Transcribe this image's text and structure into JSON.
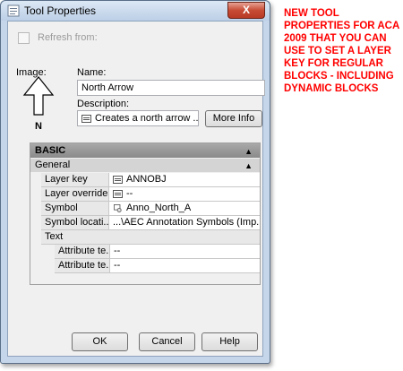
{
  "window": {
    "title": "Tool Properties",
    "close_symbol": "X"
  },
  "refresh": {
    "label": "Refresh from:"
  },
  "image": {
    "label": "Image:",
    "icon": "north-arrow-icon",
    "icon_letter": "N"
  },
  "name": {
    "label": "Name:",
    "value": "North Arrow"
  },
  "description": {
    "label": "Description:",
    "value": "Creates a north arrow ..."
  },
  "more_info": {
    "label": "More Info"
  },
  "grid": {
    "section": "BASIC",
    "category": "General",
    "collapse_symbol": "▲",
    "rows": [
      {
        "key": "Layer key",
        "value": "ANNOBJ",
        "icon": "doc-icon"
      },
      {
        "key": "Layer overrides",
        "value": "--",
        "icon": "doc-icon"
      },
      {
        "key": "Symbol",
        "value": "Anno_North_A",
        "icon": "block-icon"
      },
      {
        "key": "Symbol locati...",
        "value": "...\\AEC Annotation Symbols (Imp..."
      }
    ],
    "text_group": "Text",
    "sub_rows": [
      {
        "key": "Attribute te...",
        "value": "--"
      },
      {
        "key": "Attribute te...",
        "value": "--"
      }
    ]
  },
  "buttons": {
    "ok": "OK",
    "cancel": "Cancel",
    "help": "Help"
  },
  "annotation": {
    "text": "NEW TOOL PROPERTIES FOR ACA 2009 THAT YOU CAN USE TO SET A LAYER KEY FOR REGULAR BLOCKS - INCLUDING DYNAMIC BLOCKS"
  },
  "colors": {
    "annotation": "#ff0000",
    "title_bar": "#c5d6ea",
    "close_button": "#c74c35"
  }
}
